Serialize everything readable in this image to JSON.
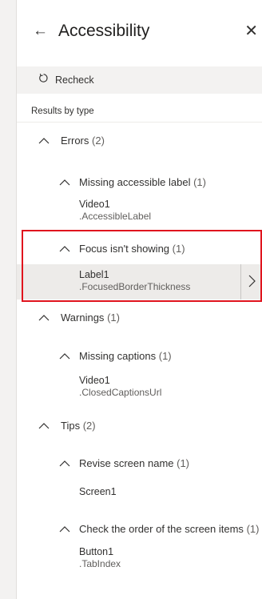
{
  "header": {
    "back_icon": "←",
    "title": "Accessibility",
    "close_icon": "✕"
  },
  "toolbar": {
    "recheck_label": "Recheck",
    "recheck_icon": "refresh-icon"
  },
  "results_label": "Results by type",
  "groups": {
    "errors": {
      "label": "Errors",
      "count": "(2)",
      "subgroups": {
        "missing_label": {
          "label": "Missing accessible label",
          "count": "(1)",
          "item_name": "Video1",
          "item_prop": ".AccessibleLabel"
        },
        "focus": {
          "label": "Focus isn't showing",
          "count": "(1)",
          "item_name": "Label1",
          "item_prop": ".FocusedBorderThickness"
        }
      }
    },
    "warnings": {
      "label": "Warnings",
      "count": "(1)",
      "subgroups": {
        "captions": {
          "label": "Missing captions",
          "count": "(1)",
          "item_name": "Video1",
          "item_prop": ".ClosedCaptionsUrl"
        }
      }
    },
    "tips": {
      "label": "Tips",
      "count": "(2)",
      "subgroups": {
        "screen_name": {
          "label": "Revise screen name",
          "count": "(1)",
          "item_name": "Screen1"
        },
        "order": {
          "label": "Check the order of the screen items",
          "count": "(1)",
          "item_name": "Button1",
          "item_prop": ".TabIndex"
        }
      }
    }
  },
  "colors": {
    "highlight_border": "#e0141e",
    "selected_background": "#edebe9",
    "page_background": "#f3f2f1"
  }
}
